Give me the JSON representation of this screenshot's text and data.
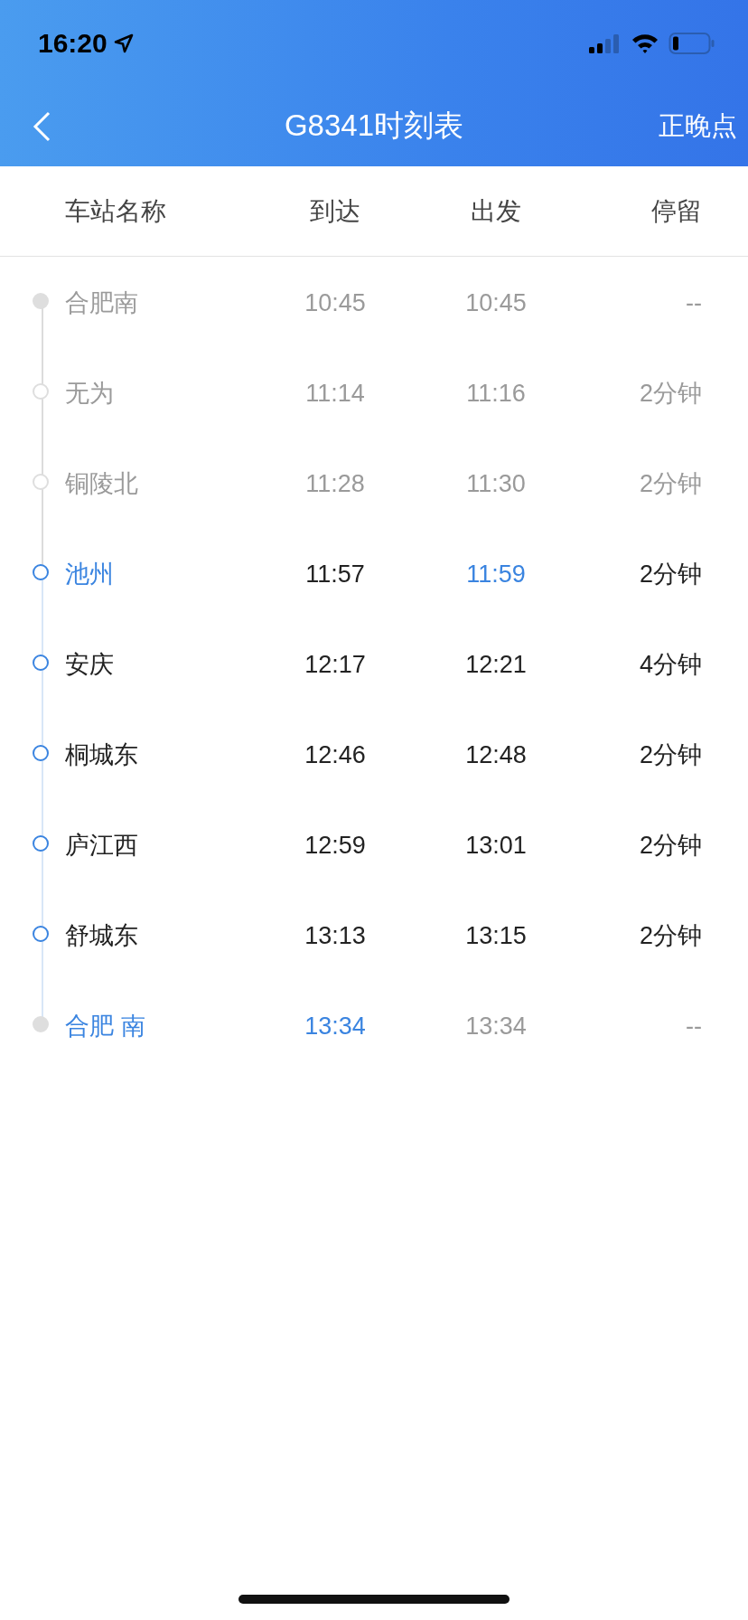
{
  "status_bar": {
    "time": "16:20"
  },
  "nav": {
    "title": "G8341时刻表",
    "action": "正晚点"
  },
  "columns": [
    "车站名称",
    "到达",
    "出发",
    "停留"
  ],
  "stops": [
    {
      "dot": {
        "kind": "filled",
        "passed": true
      },
      "station": {
        "text": "合肥南",
        "passed": true,
        "highlighted": false
      },
      "arrive": {
        "text": "10:45",
        "passed": true,
        "highlighted": false
      },
      "depart": {
        "text": "10:45",
        "passed": true,
        "highlighted": false
      },
      "stay": {
        "text": "--",
        "passed": true,
        "highlighted": false
      }
    },
    {
      "dot": {
        "kind": "ring",
        "passed": true
      },
      "station": {
        "text": "无为",
        "passed": true,
        "highlighted": false
      },
      "arrive": {
        "text": "11:14",
        "passed": true,
        "highlighted": false
      },
      "depart": {
        "text": "11:16",
        "passed": true,
        "highlighted": false
      },
      "stay": {
        "text": "2分钟",
        "passed": true,
        "highlighted": false
      }
    },
    {
      "dot": {
        "kind": "ring",
        "passed": true
      },
      "station": {
        "text": "铜陵北",
        "passed": true,
        "highlighted": false
      },
      "arrive": {
        "text": "11:28",
        "passed": true,
        "highlighted": false
      },
      "depart": {
        "text": "11:30",
        "passed": true,
        "highlighted": false
      },
      "stay": {
        "text": "2分钟",
        "passed": true,
        "highlighted": false
      }
    },
    {
      "dot": {
        "kind": "ring",
        "passed": false
      },
      "station": {
        "text": "池州",
        "highlighted": true
      },
      "arrive": {
        "text": "11:57",
        "passed": false,
        "highlighted": false
      },
      "depart": {
        "text": "11:59",
        "highlighted": true
      },
      "stay": {
        "text": "2分钟",
        "passed": false,
        "highlighted": false
      }
    },
    {
      "dot": {
        "kind": "ring",
        "passed": false
      },
      "station": {
        "text": "安庆",
        "passed": false,
        "highlighted": false
      },
      "arrive": {
        "text": "12:17",
        "passed": false,
        "highlighted": false
      },
      "depart": {
        "text": "12:21",
        "passed": false,
        "highlighted": false
      },
      "stay": {
        "text": "4分钟",
        "passed": false,
        "highlighted": false
      }
    },
    {
      "dot": {
        "kind": "ring",
        "passed": false
      },
      "station": {
        "text": "桐城东",
        "passed": false,
        "highlighted": false
      },
      "arrive": {
        "text": "12:46",
        "passed": false,
        "highlighted": false
      },
      "depart": {
        "text": "12:48",
        "passed": false,
        "highlighted": false
      },
      "stay": {
        "text": "2分钟",
        "passed": false,
        "highlighted": false
      }
    },
    {
      "dot": {
        "kind": "ring",
        "passed": false
      },
      "station": {
        "text": "庐江西",
        "passed": false,
        "highlighted": false
      },
      "arrive": {
        "text": "12:59",
        "passed": false,
        "highlighted": false
      },
      "depart": {
        "text": "13:01",
        "passed": false,
        "highlighted": false
      },
      "stay": {
        "text": "2分钟",
        "passed": false,
        "highlighted": false
      }
    },
    {
      "dot": {
        "kind": "ring",
        "passed": false
      },
      "station": {
        "text": "舒城东",
        "passed": false,
        "highlighted": false
      },
      "arrive": {
        "text": "13:13",
        "passed": false,
        "highlighted": false
      },
      "depart": {
        "text": "13:15",
        "passed": false,
        "highlighted": false
      },
      "stay": {
        "text": "2分钟",
        "passed": false,
        "highlighted": false
      }
    },
    {
      "dot": {
        "kind": "filled",
        "passed": true
      },
      "station": {
        "text": "合肥 南",
        "highlighted": true
      },
      "arrive": {
        "text": "13:34",
        "highlighted": true
      },
      "depart": {
        "text": "13:34",
        "passed": true,
        "highlighted": false
      },
      "stay": {
        "text": "--",
        "passed": true,
        "highlighted": false
      }
    }
  ]
}
